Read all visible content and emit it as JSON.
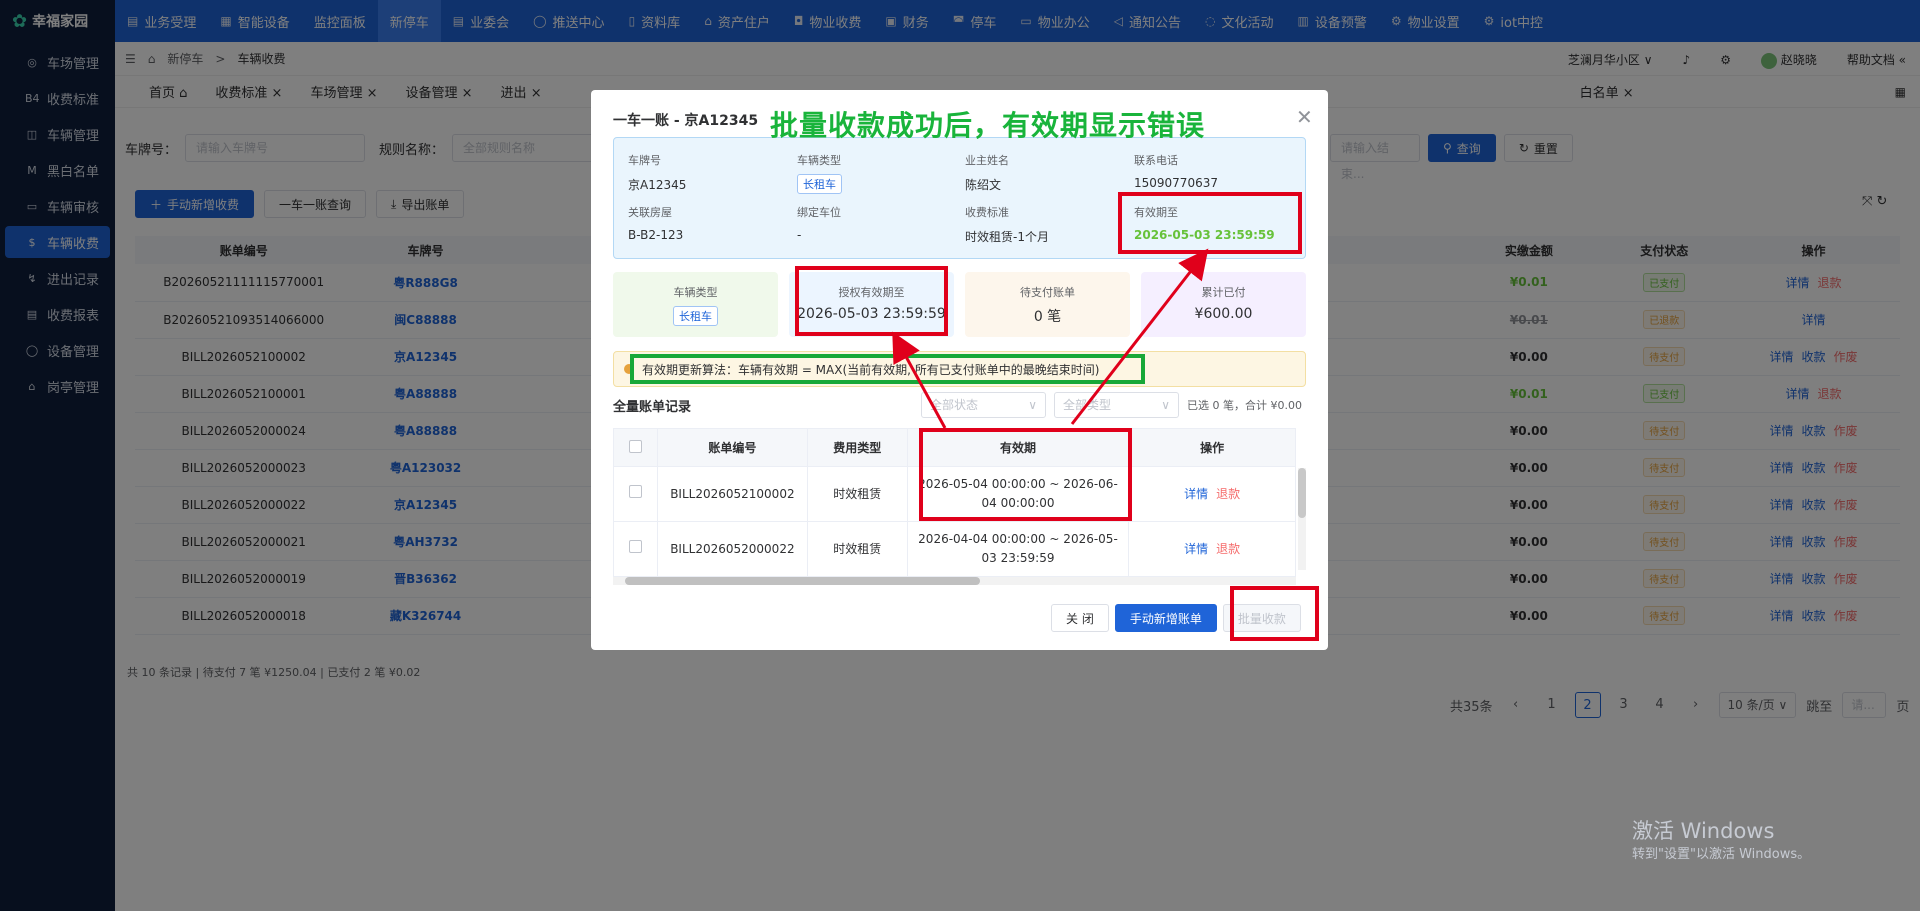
{
  "app": {
    "logo_text": "幸福家园",
    "top_nav": [
      {
        "label": "业务受理",
        "icon": "▤"
      },
      {
        "label": "智能设备",
        "icon": "▦"
      },
      {
        "label": "监控面板",
        "icon": ""
      },
      {
        "label": "新停车",
        "icon": "",
        "active": true
      },
      {
        "label": "业委会",
        "icon": "▤"
      },
      {
        "label": "推送中心",
        "icon": "◯"
      },
      {
        "label": "资料库",
        "icon": "▯"
      },
      {
        "label": "资产住户",
        "icon": "⌂"
      },
      {
        "label": "物业收费",
        "icon": "◘"
      },
      {
        "label": "财务",
        "icon": "▣"
      },
      {
        "label": "停车",
        "icon": "◚"
      },
      {
        "label": "物业办公",
        "icon": "▭"
      },
      {
        "label": "通知公告",
        "icon": "◁"
      },
      {
        "label": "文化活动",
        "icon": "◌"
      },
      {
        "label": "设备预警",
        "icon": "▥"
      },
      {
        "label": "物业设置",
        "icon": "⚙"
      },
      {
        "label": "iot中控",
        "icon": "⚙"
      }
    ],
    "sidebar": [
      {
        "label": "车场管理",
        "icon": "◎"
      },
      {
        "label": "收费标准",
        "icon": "B4"
      },
      {
        "label": "车辆管理",
        "icon": "◫"
      },
      {
        "label": "黑白名单",
        "icon": "M"
      },
      {
        "label": "车辆审核",
        "icon": "▭"
      },
      {
        "label": "车辆收费",
        "icon": "$",
        "active": true
      },
      {
        "label": "进出记录",
        "icon": "↯"
      },
      {
        "label": "收费报表",
        "icon": "▤"
      },
      {
        "label": "设备管理",
        "icon": "◯"
      },
      {
        "label": "岗亭管理",
        "icon": "⌂"
      }
    ],
    "breadcrumb": {
      "parent": "新停车",
      "sep": ">",
      "current": "车辆收费"
    },
    "header_right": {
      "community": "芝澜月华小区",
      "user": "赵晓晓",
      "help": "帮助文档"
    },
    "tabs": [
      {
        "label": "首页"
      },
      {
        "label": "收费标准"
      },
      {
        "label": "车场管理"
      },
      {
        "label": "设备管理"
      },
      {
        "label": "进出"
      },
      {
        "label": "白名单"
      }
    ],
    "filters": {
      "plate_label": "车牌号：",
      "plate_placeholder": "请输入车牌号",
      "rule_label": "规则名称：",
      "rule_placeholder": "全部规则名称",
      "end_placeholder": "请输入结束...",
      "query": "查询",
      "reset": "重置"
    },
    "actions": {
      "add_manual": "手动新增收费",
      "one_car": "一车一账查询",
      "export": "导出账单"
    },
    "table": {
      "headers": [
        "账单编号",
        "车牌号",
        "实缴金额",
        "支付状态",
        "操作"
      ],
      "rows": [
        {
          "id": "B20260521111115770001",
          "plate": "粤R888G8",
          "amount": "¥0.01",
          "status": "已支付",
          "status_type": "paid",
          "ops": [
            "详情",
            "退款"
          ]
        },
        {
          "id": "B20260521093514066000",
          "plate": "闽C88888",
          "amount": "¥0.01",
          "status": "已退款",
          "status_type": "ref",
          "ops": [
            "详情"
          ]
        },
        {
          "id": "BILL2026052100002",
          "plate": "京A12345",
          "amount": "¥0.00",
          "status": "待支付",
          "status_type": "pend",
          "ops": [
            "详情",
            "收款",
            "作废"
          ]
        },
        {
          "id": "BILL2026052100001",
          "plate": "粤A88888",
          "amount": "¥0.01",
          "status": "已支付",
          "status_type": "paid",
          "ops": [
            "详情",
            "退款"
          ]
        },
        {
          "id": "BILL2026052000024",
          "plate": "粤A88888",
          "amount": "¥0.00",
          "status": "待支付",
          "status_type": "pend",
          "ops": [
            "详情",
            "收款",
            "作废"
          ]
        },
        {
          "id": "BILL2026052000023",
          "plate": "粤A123032",
          "amount": "¥0.00",
          "status": "待支付",
          "status_type": "pend",
          "ops": [
            "详情",
            "收款",
            "作废"
          ]
        },
        {
          "id": "BILL2026052000022",
          "plate": "京A12345",
          "amount": "¥0.00",
          "status": "待支付",
          "status_type": "pend",
          "ops": [
            "详情",
            "收款",
            "作废"
          ]
        },
        {
          "id": "BILL2026052000021",
          "plate": "粤AH3732",
          "amount": "¥0.00",
          "status": "待支付",
          "status_type": "pend",
          "ops": [
            "详情",
            "收款",
            "作废"
          ]
        },
        {
          "id": "BILL2026052000019",
          "plate": "晋B36362",
          "amount": "¥0.00",
          "status": "待支付",
          "status_type": "pend",
          "ops": [
            "详情",
            "收款",
            "作废"
          ]
        },
        {
          "id": "BILL2026052000018",
          "plate": "藏K326744",
          "amount": "¥0.00",
          "status": "待支付",
          "status_type": "pend",
          "ops": [
            "详情",
            "收款",
            "作废"
          ]
        }
      ],
      "summary": "共 10 条记录 | 待支付 7 笔 ¥1250.04 | 已支付 2 笔 ¥0.02"
    },
    "pagination": {
      "total": "共35条",
      "pages": [
        "1",
        "2",
        "3",
        "4"
      ],
      "current": "2",
      "page_size": "10 条/页",
      "jump": "跳至",
      "jump_placeholder": "请...",
      "page_unit": "页"
    },
    "windows": {
      "line1": "激活 Windows",
      "line2": "转到\"设置\"以激活 Windows。"
    }
  },
  "modal": {
    "title": "一车一账 - 京A12345",
    "annotation": "批量收款成功后，有效期显示错误",
    "info": {
      "plate_label": "车牌号",
      "plate": "京A12345",
      "type_label": "车辆类型",
      "type": "长租车",
      "owner_label": "业主姓名",
      "owner": "陈绍文",
      "phone_label": "联系电话",
      "phone": "15090770637",
      "room_label": "关联房屋",
      "room": "B-B2-123",
      "space_label": "绑定车位",
      "space": "-",
      "standard_label": "收费标准",
      "standard": "时效租赁-1个月",
      "expire_label": "有效期至",
      "expire": "2026-05-03 23:59:59"
    },
    "stats": [
      {
        "label": "车辆类型",
        "value": "长租车"
      },
      {
        "label": "授权有效期至",
        "value": "2026-05-03 23:59:59"
      },
      {
        "label": "待支付账单",
        "value": "0 笔"
      },
      {
        "label": "累计已付",
        "value": "¥600.00"
      }
    ],
    "algorithm": "有效期更新算法：车辆有效期 = MAX(当前有效期, 所有已支付账单中的最晚结束时间)",
    "records_title": "全量账单记录",
    "filter_status": "全部状态",
    "filter_type": "全部类型",
    "selected_summary": "已选 0 笔，合计 ¥0.00",
    "table_headers": [
      "账单编号",
      "费用类型",
      "有效期",
      "操作"
    ],
    "rows": [
      {
        "id": "BILL2026052100002",
        "type": "时效租赁",
        "period": "2026-05-04 00:00:00 ~ 2026-06-04 00:00:00",
        "ops": [
          "详情",
          "退款"
        ]
      },
      {
        "id": "BILL2026052000022",
        "type": "时效租赁",
        "period": "2026-04-04 00:00:00 ~ 2026-05-03 23:59:59",
        "ops": [
          "详情",
          "退款"
        ]
      }
    ],
    "buttons": {
      "close": "关 闭",
      "add": "手动新增账单",
      "batch": "批量收款"
    }
  }
}
